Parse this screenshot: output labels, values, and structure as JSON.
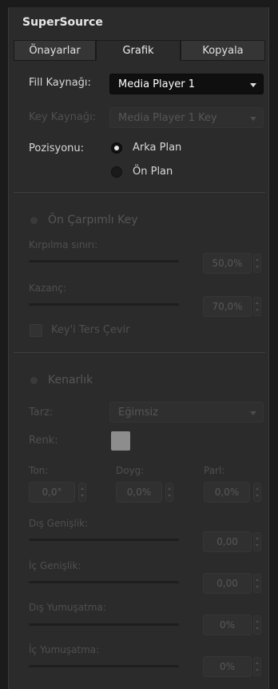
{
  "title": "SuperSource",
  "tabs": [
    "Önayarlar",
    "Grafik",
    "Kopyala"
  ],
  "active_tab": "Grafik",
  "fill": {
    "label": "Fill Kaynağı:",
    "value": "Media Player 1"
  },
  "key": {
    "label": "Key Kaynağı:",
    "value": "Media Player 1 Key"
  },
  "position": {
    "label": "Pozisyonu:",
    "options": [
      "Arka Plan",
      "Ön Plan"
    ],
    "selected": "Arka Plan"
  },
  "premult": {
    "title": "Ön Çarpımlı Key",
    "clip_label": "Kırpılma sınırı:",
    "clip_value": "50,0%",
    "gain_label": "Kazanç:",
    "gain_value": "70,0%",
    "invert_label": "Key'i Ters Çevir"
  },
  "border": {
    "title": "Kenarlık",
    "style_label": "Tarz:",
    "style_value": "Eğimsiz",
    "color_label": "Renk:",
    "color_hex": "#8d8d8d",
    "hue_label": "Ton:",
    "hue_value": "0,0°",
    "sat_label": "Doyg:",
    "sat_value": "0,0%",
    "lum_label": "Parl:",
    "lum_value": "0,0%",
    "outer_width_label": "Dış Genişlik:",
    "outer_width_value": "0,00",
    "inner_width_label": "İç Genişlik:",
    "inner_width_value": "0,00",
    "outer_soft_label": "Dış Yumuşatma:",
    "outer_soft_value": "0%",
    "inner_soft_label": "İç Yumuşatma:",
    "inner_soft_value": "0%"
  }
}
